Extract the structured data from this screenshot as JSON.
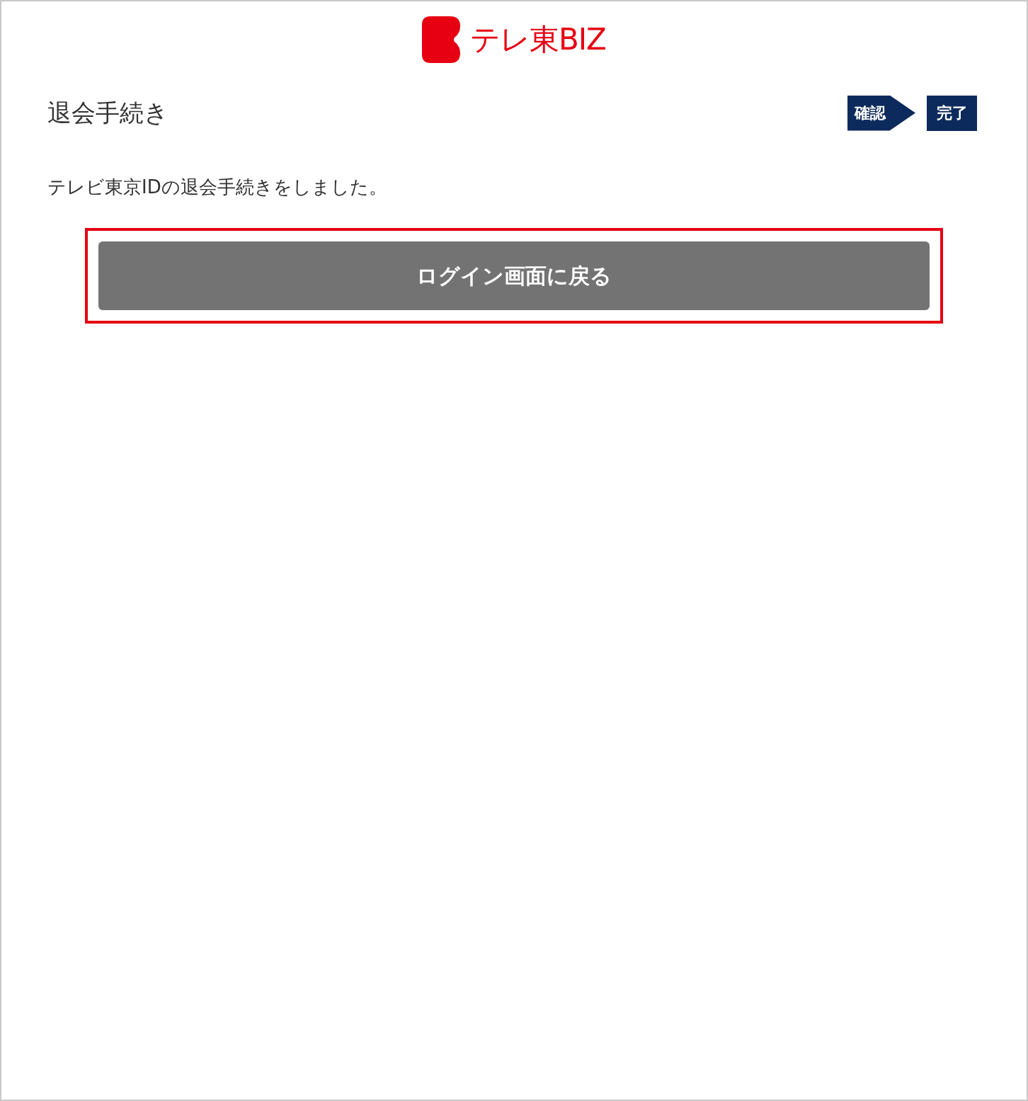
{
  "logo": {
    "text": "テレ東BIZ"
  },
  "page_title": "退会手続き",
  "steps": [
    {
      "label": "確認",
      "kind": "arrow"
    },
    {
      "label": "完了",
      "kind": "plain"
    }
  ],
  "message": "テレビ東京IDの退会手続きをしました。",
  "back_button": {
    "label": "ログイン画面に戻る",
    "highlighted": true
  }
}
